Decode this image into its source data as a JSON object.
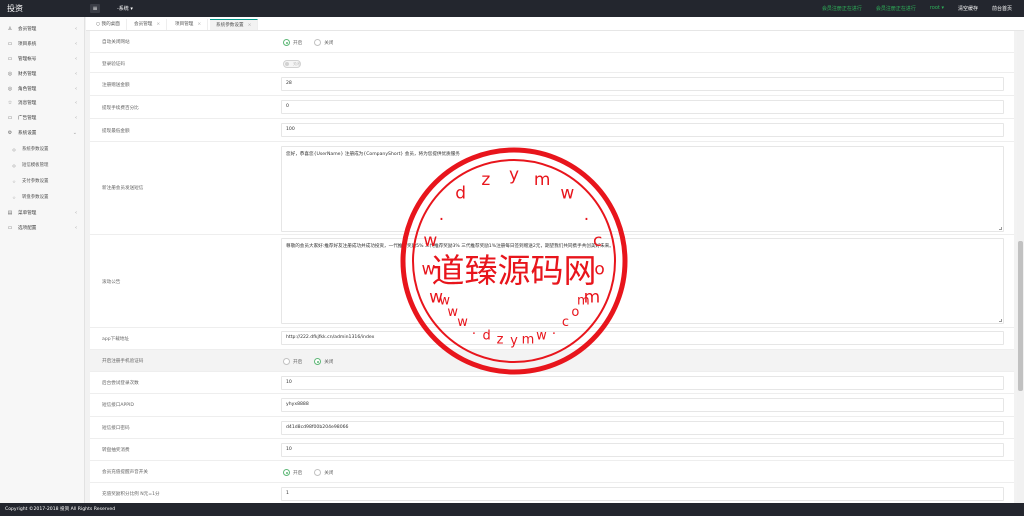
{
  "app": {
    "logo": "投资",
    "menu_toggle": "≡",
    "nav_dropdown": "-系统 ▾"
  },
  "topbar": {
    "link1": "会员注册正在进行",
    "link2": "会员注册正在进行",
    "user": "root ▾",
    "clear_cache": "清空缓存",
    "home": "前台首页"
  },
  "sidebar": {
    "items": [
      {
        "icon": "user-icon",
        "glyph": "♙",
        "label": "会员管理"
      },
      {
        "icon": "project-icon",
        "glyph": "▭",
        "label": "项目系统"
      },
      {
        "icon": "account-icon",
        "glyph": "▭",
        "label": "管理帐号"
      },
      {
        "icon": "finance-icon",
        "glyph": "◎",
        "label": "财务管理"
      },
      {
        "icon": "role-icon",
        "glyph": "◎",
        "label": "角色管理"
      },
      {
        "icon": "message-icon",
        "glyph": "☆",
        "label": "消息管理"
      },
      {
        "icon": "ad-icon",
        "glyph": "▭",
        "label": "广告管理"
      },
      {
        "icon": "settings-icon",
        "glyph": "⚙",
        "label": "系统设置"
      }
    ],
    "sub_items": [
      {
        "icon": "gear-icon",
        "glyph": "◎",
        "label": "系统参数设置"
      },
      {
        "icon": "sms-icon",
        "glyph": "◎",
        "label": "短信模板管理"
      },
      {
        "icon": "star-icon",
        "glyph": "☆",
        "label": "支付参数设置"
      },
      {
        "icon": "star-icon",
        "glyph": "☆",
        "label": "转盘参数设置"
      }
    ],
    "bottom_items": [
      {
        "icon": "menu-icon",
        "glyph": "▤",
        "label": "菜单管理"
      },
      {
        "icon": "option-icon",
        "glyph": "▭",
        "label": "选项配置"
      }
    ]
  },
  "tabs": [
    {
      "label": "我的桌面",
      "icon": "○"
    },
    {
      "label": "会员管理",
      "close": "×"
    },
    {
      "label": "项目管理",
      "close": "×"
    },
    {
      "label": "系统参数设置",
      "close": "×"
    }
  ],
  "form": {
    "auto_close": {
      "label": "自动关闭网站",
      "on": "开启",
      "off": "关闭"
    },
    "login_captcha": {
      "label": "登录验证码",
      "switch_text": "关闭"
    },
    "reg_bonus": {
      "label": "注册赠送金额",
      "value": "28"
    },
    "withdraw_fee": {
      "label": "提现手续费百分比",
      "value": "0"
    },
    "withdraw_min": {
      "label": "提现最低金额",
      "value": "100"
    },
    "new_member_sms": {
      "label": "新注册会员发送短信",
      "value": "您好，恭喜您{UserName} 注册成为{CompanyShort} 会员，将为您提供优质服务"
    },
    "scroll_notice": {
      "label": "滚动公告",
      "value": "尊敬的会员大家好:推荐好友注册成功并成功投资，一代推荐奖励5%  二代推荐奖励3%  三代推荐奖励1%注册每日签到赠送2元，期望我们共同携手共创美好未来。"
    },
    "app_url": {
      "label": "app下载地址",
      "value": "http://222.dfkjfkk.cn/admin1316/index"
    },
    "mobile_verify": {
      "label": "开启注册手机验证码",
      "on": "开启",
      "off": "关闭"
    },
    "login_attempts": {
      "label": "后台尝试登录次数",
      "value": "10"
    },
    "sms_appid": {
      "label": "短信接口APPID",
      "value": "yhyx8888"
    },
    "sms_password": {
      "label": "短信接口密码",
      "value": "d41d8cd98f00b204e98066"
    },
    "wheel_cost": {
      "label": "转盘抽奖消费",
      "value": "10"
    },
    "voice_switch": {
      "label": "会员充值提醒声音开关",
      "on": "开启",
      "off": "关闭"
    },
    "recharge_ratio": {
      "label": "充值奖励积分比例 N元=1分",
      "value": "1"
    }
  },
  "watermark": {
    "brand": "道臻源码网",
    "top_arc": [
      "w",
      "w",
      "w",
      ".",
      "d",
      "z",
      "y",
      "m",
      "w",
      ".",
      "c",
      "o",
      "m"
    ],
    "bottom_arc": [
      "w",
      "w",
      "w",
      ".",
      "d",
      "z",
      "y",
      "m",
      "w",
      ".",
      "c",
      "o",
      "m"
    ],
    "color": "#e8151c"
  },
  "footer": {
    "text": "Copyright ©2017-2018 投资 All Rights Reserved"
  }
}
